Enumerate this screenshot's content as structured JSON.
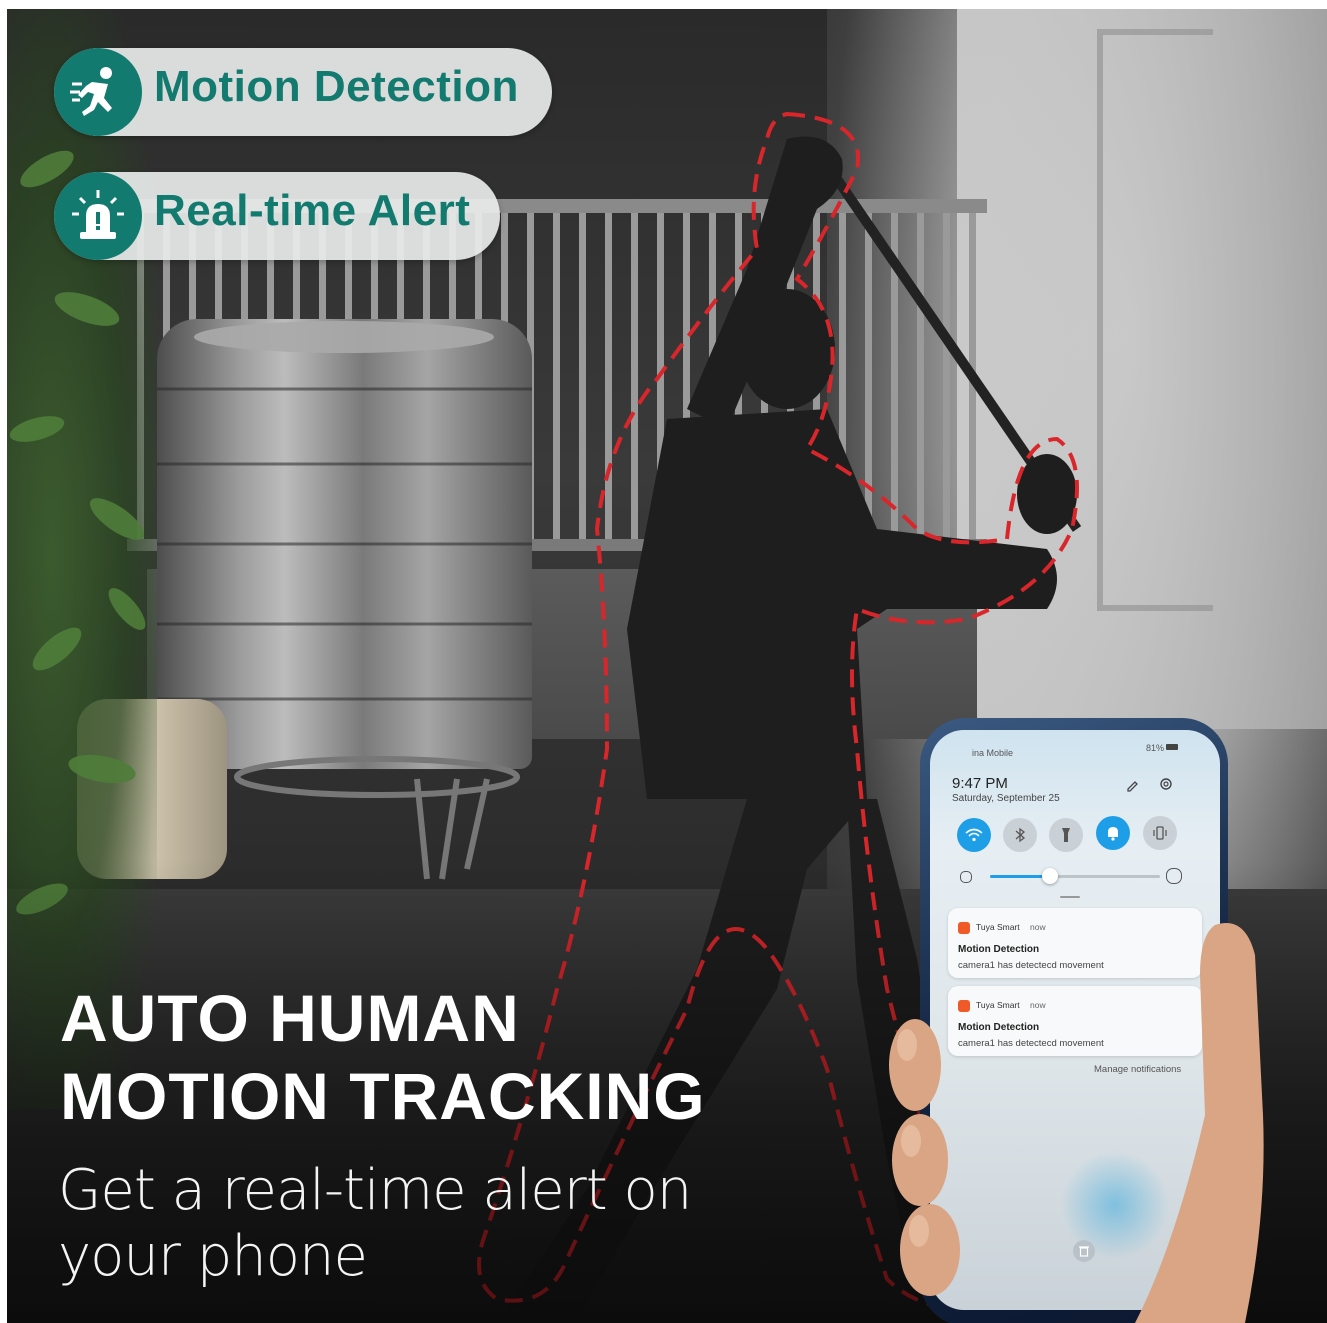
{
  "badges": [
    {
      "icon": "running-person-icon",
      "label": "Motion Detection"
    },
    {
      "icon": "alarm-siren-icon",
      "label": "Real-time Alert"
    }
  ],
  "headline": {
    "line1": "AUTO HUMAN",
    "line2": "MOTION TRACKING"
  },
  "subtitle": {
    "line1": "Get a real-time alert on",
    "line2": "your phone"
  },
  "colors": {
    "accent": "#137a6f",
    "tracking_outline": "#d9262b",
    "toggle_on": "#1f9ee8"
  },
  "phone": {
    "status_bar": {
      "carrier": "ina Mobile",
      "battery": "81%"
    },
    "time": "9:47 PM",
    "date": "Saturday, September 25",
    "quick_settings": [
      {
        "icon": "wifi-icon",
        "active": true
      },
      {
        "icon": "bluetooth-icon",
        "active": false
      },
      {
        "icon": "flashlight-icon",
        "active": false
      },
      {
        "icon": "bell-icon",
        "active": true
      },
      {
        "icon": "vibrate-icon",
        "active": false
      }
    ],
    "brightness_level": 0.35,
    "notifications": [
      {
        "app": "Tuya Smart",
        "time": "now",
        "title": "Motion Detection",
        "body": "camera1 has detectecd movement"
      },
      {
        "app": "Tuya Smart",
        "time": "now",
        "title": "Motion Detection",
        "body": "camera1 has detectecd movement"
      }
    ],
    "manage_label": "Manage notifications"
  }
}
